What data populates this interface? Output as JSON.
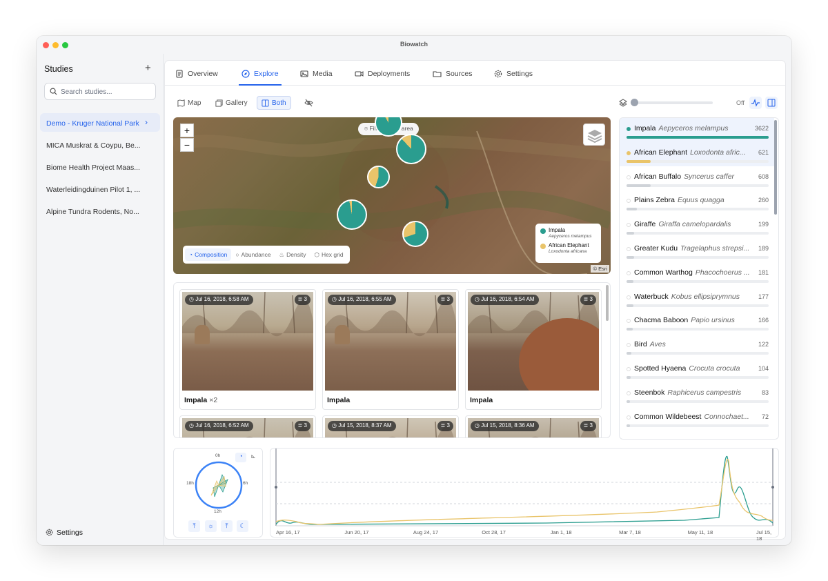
{
  "window": {
    "title": "Biowatch"
  },
  "sidebar": {
    "heading": "Studies",
    "add_icon": "plus-icon",
    "search_placeholder": "Search studies...",
    "studies": [
      {
        "label": "Demo - Kruger National Park",
        "active": true
      },
      {
        "label": "MICA Muskrat & Coypu, Be..."
      },
      {
        "label": "Biome Health Project Maas..."
      },
      {
        "label": "Waterleidingduinen Pilot 1, ..."
      },
      {
        "label": "Alpine Tundra Rodents, No..."
      }
    ],
    "settings_label": "Settings"
  },
  "tabs": [
    {
      "label": "Overview",
      "icon": "document-icon"
    },
    {
      "label": "Explore",
      "icon": "compass-icon",
      "active": true
    },
    {
      "label": "Media",
      "icon": "image-icon"
    },
    {
      "label": "Deployments",
      "icon": "camera-icon"
    },
    {
      "label": "Sources",
      "icon": "folder-icon"
    },
    {
      "label": "Settings",
      "icon": "gear-icon"
    }
  ],
  "view_buttons": [
    {
      "label": "Map",
      "icon": "map-icon"
    },
    {
      "label": "Gallery",
      "icon": "gallery-icon"
    },
    {
      "label": "Both",
      "icon": "columns-icon",
      "active": true
    }
  ],
  "controls": {
    "toggle_label": "Off",
    "slider_value": 0
  },
  "map": {
    "zoom_in": "+",
    "zoom_out": "−",
    "filter_label": "Filter to this area",
    "attribution": "© Esri",
    "modes": [
      {
        "label": "Composition",
        "active": true
      },
      {
        "label": "Abundance"
      },
      {
        "label": "Density"
      },
      {
        "label": "Hex grid"
      }
    ],
    "legend": [
      {
        "name": "Impala",
        "latin": "Aepyceros melampus",
        "color": "#2a9d8f"
      },
      {
        "name": "African Elephant",
        "latin": "Loxodonta africana",
        "color": "#e9c46a"
      }
    ],
    "pies": [
      {
        "impala_share": 0.92
      },
      {
        "impala_share": 0.88
      },
      {
        "impala_share": 0.55
      },
      {
        "impala_share": 0.97
      },
      {
        "impala_share": 0.7
      }
    ]
  },
  "gallery": [
    {
      "timestamp": "Jul 16, 2018, 6:58 AM",
      "count": "3",
      "label": "Impala",
      "multiplier": "×2"
    },
    {
      "timestamp": "Jul 16, 2018, 6:55 AM",
      "count": "3",
      "label": "Impala",
      "multiplier": ""
    },
    {
      "timestamp": "Jul 16, 2018, 6:54 AM",
      "count": "3",
      "label": "Impala",
      "multiplier": ""
    },
    {
      "timestamp": "Jul 16, 2018, 6:52 AM",
      "count": "3",
      "label": "",
      "multiplier": ""
    },
    {
      "timestamp": "Jul 15, 2018, 8:37 AM",
      "count": "3",
      "label": "",
      "multiplier": ""
    },
    {
      "timestamp": "Jul 15, 2018, 8:36 AM",
      "count": "3",
      "label": "",
      "multiplier": ""
    }
  ],
  "species": [
    {
      "name": "Impala",
      "latin": "Aepyceros melampus",
      "count": "3622",
      "color": "#2a9d8f",
      "selected": true
    },
    {
      "name": "African Elephant",
      "latin": "Loxodonta afric...",
      "count": "621",
      "color": "#e9c46a",
      "selected": true
    },
    {
      "name": "African Buffalo",
      "latin": "Syncerus caffer",
      "count": "608"
    },
    {
      "name": "Plains Zebra",
      "latin": "Equus quagga",
      "count": "260"
    },
    {
      "name": "Giraffe",
      "latin": "Giraffa camelopardalis",
      "count": "199"
    },
    {
      "name": "Greater Kudu",
      "latin": "Tragelaphus strepsi...",
      "count": "189"
    },
    {
      "name": "Common Warthog",
      "latin": "Phacochoerus ...",
      "count": "181"
    },
    {
      "name": "Waterbuck",
      "latin": "Kobus ellipsiprymnus",
      "count": "177"
    },
    {
      "name": "Chacma Baboon",
      "latin": "Papio ursinus",
      "count": "166"
    },
    {
      "name": "Bird",
      "latin": "Aves",
      "count": "122"
    },
    {
      "name": "Spotted Hyaena",
      "latin": "Crocuta crocuta",
      "count": "104"
    },
    {
      "name": "Steenbok",
      "latin": "Raphicerus campestris",
      "count": "83"
    },
    {
      "name": "Common Wildebeest",
      "latin": "Connochaet...",
      "count": "72"
    }
  ],
  "daily_activity": {
    "labels": {
      "top": "0h",
      "right": "6h",
      "bottom": "12h",
      "left": "18h"
    },
    "buttons": [
      "upload-icon",
      "sun-icon",
      "upload-icon",
      "moon-icon"
    ]
  },
  "timeline": {
    "x_labels": [
      "Apr 16, 17",
      "Jun 20, 17",
      "Aug 24, 17",
      "Oct 28, 17",
      "Jan 1, 18",
      "Mar 7, 18",
      "May 11, 18",
      "Jul 15, 18"
    ]
  }
}
